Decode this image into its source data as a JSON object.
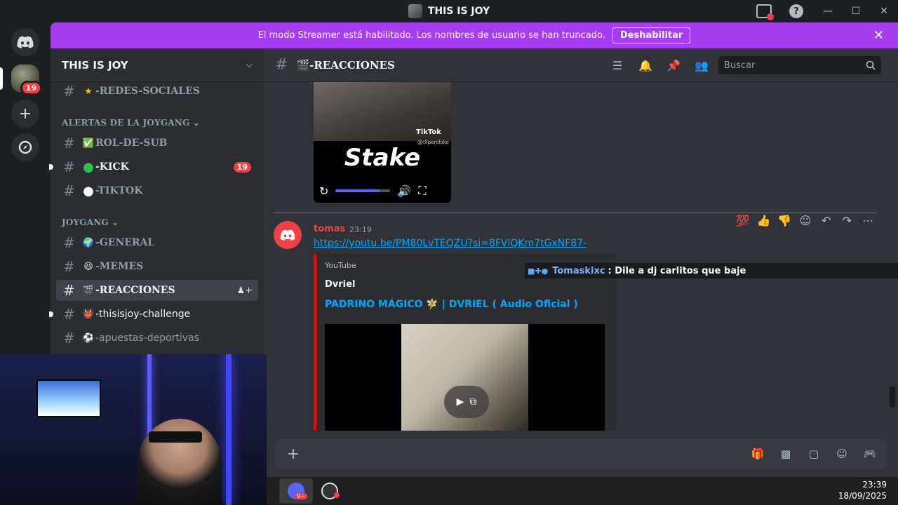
{
  "window": {
    "title": "THIS IS JOY"
  },
  "banner": {
    "text": "El modo Streamer está habilitado. Los nombres de usuario se han truncado.",
    "button": "Deshabilitar"
  },
  "rail": {
    "server_badge": "19"
  },
  "server": {
    "name": "THIS IS JOY"
  },
  "channels": [
    {
      "emoji": "★",
      "name": "-REDES-SOCIALES",
      "unread": false
    },
    {
      "category": "ALERTAS DE LA JOYGANG"
    },
    {
      "emoji": "✅",
      "name": "ROL-DE-SUB",
      "unread": false
    },
    {
      "emoji": "●",
      "name": "-KICK",
      "unread": true,
      "badge": "19"
    },
    {
      "emoji": "●",
      "name": "-TIKTOK",
      "unread": false
    },
    {
      "category": "JOYGANG"
    },
    {
      "emoji": "🌍",
      "name": "-GENERAL",
      "unread": false
    },
    {
      "emoji": "😆",
      "name": "-MEMES",
      "unread": false
    },
    {
      "emoji": "🎬",
      "name": "-REACCIONES",
      "active": true
    },
    {
      "emoji": "👹",
      "name": "-thisisjoy-challenge",
      "unread": true
    },
    {
      "emoji": "⚽",
      "name": "-apuestas-deportivas",
      "unread": false
    }
  ],
  "chat": {
    "channel_title": "🎬-REACCIONES",
    "search_placeholder": "Buscar",
    "video": {
      "tiktok_label": "TikTok",
      "tiktok_handle": "@cliperoloko",
      "overlay_text": "Stake",
      "progress": 0.8
    },
    "message": {
      "author": "tomas",
      "time": "23:19",
      "link": "https://youtu.be/PM80LvTEQZU?si=8FVlQKm7tGxNF87-",
      "embed": {
        "provider": "YouTube",
        "author": "Dvriel",
        "title": "PADRINO MÁGICO 🧚 | DVRIEL ( Audio Oficial )",
        "color": "#ff0000"
      }
    },
    "reactions": [
      "💯",
      "👍",
      "👎"
    ],
    "overlay_chat": {
      "user": "Tomaskixc",
      "message": ": Dile a dj carlitos que baje"
    }
  },
  "taskbar": {
    "time": "23:39",
    "date": "18/09/2025",
    "discord_badge": "9+"
  },
  "colors": {
    "banner": "#a63df0",
    "accent": "#5865f2",
    "link": "#00a8fc",
    "danger": "#f23f43"
  }
}
